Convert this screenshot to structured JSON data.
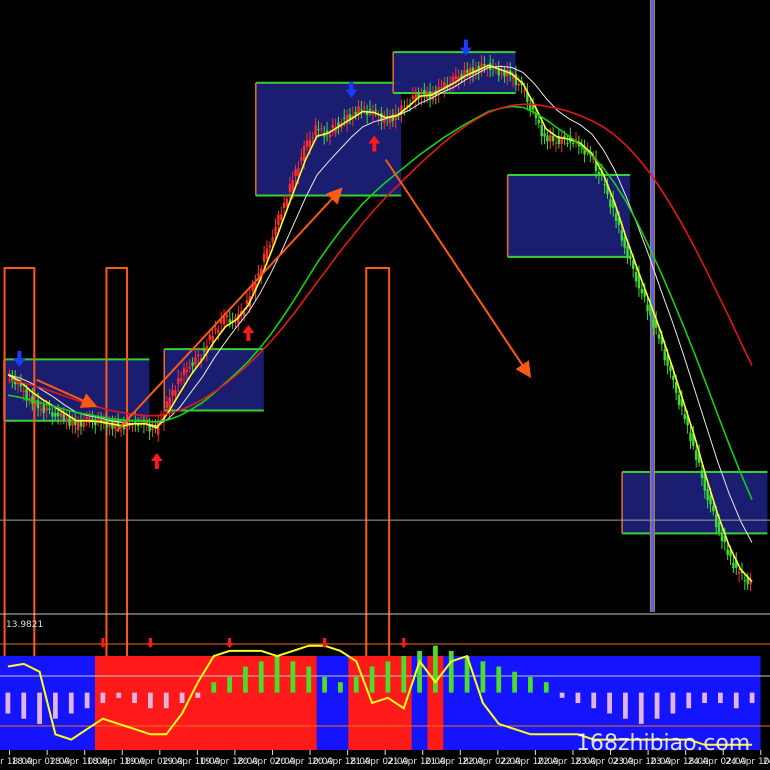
{
  "colors": {
    "background": "#000000",
    "bull_candle": "#ff2d2d",
    "bear_candle": "#3cdc3c",
    "zone_fill": "#1c1f7a",
    "zone_border_main": "#34d134",
    "zone_border_side": "#e8701e",
    "ma_white": "#e8e8e8",
    "ma_yellow": "#ffff33",
    "ma_green": "#16d016",
    "ma_red": "#e01818",
    "trend_arrow": "#ff5a14",
    "highlight_rect": "#ff5a14",
    "signal_up": "#ff1a1a",
    "signal_down": "#1e3cff",
    "vline": "#3a6cff",
    "hline": "#a0a0a0",
    "ind_blue": "#1414ff",
    "ind_red": "#ff1a1a",
    "ind_green_hist": "#4cdc2c",
    "ind_pink_hist": "#e2b4e2",
    "ind_yellow_line": "#ffff1e",
    "ind_level_line": "#e8701e",
    "separator": "#c8c8c8",
    "text": "#e0e0e0"
  },
  "chart_data": [
    {
      "type": "candlestick",
      "title": "",
      "price_series": [
        100,
        99,
        97.5,
        96.8,
        96.3,
        95.8,
        95,
        95.5,
        95.4,
        95.1,
        94.9,
        95.4,
        95.2,
        94.5,
        97,
        99.5,
        101,
        102,
        104,
        105.5,
        105.2,
        107,
        110,
        113,
        116,
        119,
        122,
        124,
        123.5,
        124.5,
        125.3,
        126,
        125.5,
        124.8,
        125.3,
        126.5,
        127.5,
        127.2,
        128,
        128.7,
        129.4,
        129.8,
        130.3,
        129.6,
        129.3,
        128,
        125.5,
        123.1,
        122.9,
        123,
        122.5,
        121.3,
        119,
        116,
        112.5,
        109.5,
        106.5,
        103.5,
        100,
        96.5,
        93,
        89,
        85.5,
        82.5,
        80.5,
        79.5
      ],
      "moving_averages": [
        {
          "color": "white",
          "values": [
            100,
            99.7,
            99.2,
            98.5,
            97.8,
            97,
            96.3,
            96,
            95.8,
            95.5,
            95.3,
            95.2,
            95.2,
            95,
            95.7,
            96.8,
            98.3,
            99.8,
            101.6,
            103.2,
            104.7,
            106.1,
            107.9,
            110,
            112.3,
            114.8,
            117.3,
            119.5,
            120.8,
            122,
            123.2,
            124.2,
            124.7,
            125,
            125.3,
            125.8,
            126.5,
            127,
            127.6,
            128.1,
            128.8,
            129.4,
            130,
            130.1,
            130,
            129.5,
            128.4,
            127,
            125.8,
            125,
            124.4,
            123.5,
            122,
            120,
            117.4,
            114.6,
            111.6,
            108.4,
            105.3,
            102,
            98.5,
            95,
            91.5,
            88.4,
            85.7,
            83.6
          ]
        },
        {
          "color": "yellow",
          "values": [
            100,
            99.4,
            98.4,
            97.6,
            96.9,
            96.2,
            95.5,
            95.5,
            95.4,
            95.2,
            95,
            95.2,
            95.2,
            94.8,
            96.3,
            98.2,
            100,
            101.5,
            103.2,
            104.7,
            105.4,
            106.8,
            109.2,
            112,
            115,
            118,
            121,
            123.3,
            123.6,
            124.3,
            125,
            125.7,
            125.6,
            125.1,
            125.3,
            126.2,
            127.2,
            127.3,
            127.9,
            128.5,
            129.2,
            129.7,
            130.2,
            129.8,
            129.4,
            128.4,
            126.3,
            124,
            123.2,
            123,
            122.6,
            121.6,
            119.6,
            116.8,
            113.4,
            110.3,
            107.3,
            104.3,
            100.9,
            97.4,
            93.9,
            90,
            86.4,
            83.3,
            81,
            79.8
          ]
        },
        {
          "color": "green",
          "values": [
            98,
            97.8,
            97.5,
            97.2,
            96.9,
            96.6,
            96.3,
            96.1,
            95.9,
            95.7,
            95.6,
            95.5,
            95.4,
            95.4,
            95.6,
            96,
            96.6,
            97.3,
            98.2,
            99.2,
            100.2,
            101.3,
            102.6,
            104,
            105.6,
            107.3,
            109.1,
            110.9,
            112.5,
            114,
            115.4,
            116.7,
            117.8,
            118.8,
            119.7,
            120.6,
            121.5,
            122.3,
            123.1,
            123.8,
            124.5,
            125.1,
            125.7,
            126,
            126.2,
            126.1,
            125.6,
            124.9,
            124.1,
            123.3,
            122.4,
            121.4,
            120.2,
            118.7,
            116.9,
            114.8,
            112.5,
            110.1,
            107.5,
            104.8,
            102,
            99.1,
            96.1,
            93.2,
            90.4,
            87.8
          ]
        },
        {
          "color": "red",
          "values": [
            99.5,
            99.3,
            99,
            98.7,
            98.3,
            97.9,
            97.5,
            97.1,
            96.8,
            96.5,
            96.3,
            96.1,
            96,
            96,
            96.2,
            96.5,
            97,
            97.6,
            98.3,
            99.1,
            100,
            101,
            102.1,
            103.3,
            104.6,
            106,
            107.5,
            109,
            110.5,
            112,
            113.4,
            114.8,
            116.1,
            117.3,
            118.4,
            119.5,
            120.6,
            121.6,
            122.6,
            123.5,
            124.3,
            125,
            125.6,
            126,
            126.3,
            126.4,
            126.4,
            126.2,
            126,
            125.7,
            125.3,
            124.8,
            124.2,
            123.4,
            122.4,
            121.2,
            119.8,
            118.2,
            116.4,
            114.5,
            112.4,
            110.2,
            107.9,
            105.6,
            103.2,
            100.9
          ]
        }
      ],
      "zones": [
        {
          "start": 0,
          "end": 12,
          "top": 101.5,
          "bottom": 95.5
        },
        {
          "start": 14,
          "end": 22,
          "top": 102.5,
          "bottom": 96.5
        },
        {
          "start": 22,
          "end": 34,
          "top": 128.5,
          "bottom": 117.5
        },
        {
          "start": 34,
          "end": 44,
          "top": 131.5,
          "bottom": 127.5
        },
        {
          "start": 44,
          "end": 54,
          "top": 119.5,
          "bottom": 111.5
        },
        {
          "start": 54,
          "end": 66,
          "top": 90.5,
          "bottom": 84.5
        }
      ],
      "signals": [
        {
          "index": 1,
          "dir": "down"
        },
        {
          "index": 13,
          "dir": "up"
        },
        {
          "index": 21,
          "dir": "up"
        },
        {
          "index": 30,
          "dir": "down"
        },
        {
          "index": 32,
          "dir": "up"
        },
        {
          "index": 40,
          "dir": "down"
        }
      ],
      "current_price_line": 85.8,
      "ylim": [
        78,
        136
      ],
      "watermark": "168zhibiao.com"
    },
    {
      "type": "histogram",
      "label": "13.9821",
      "x_tick_labels": [
        "17 Apr 18:00",
        "18 Apr 02:00",
        "18 Apr 10:00",
        "18 Apr 18:00",
        "19 Apr 02:00",
        "19 Apr 10:00",
        "19 Apr 18:00",
        "20 Apr 02:00",
        "20 Apr 10:00",
        "20 Apr 18:00",
        "21 Apr 02:00",
        "21 Apr 10:00",
        "21 Apr 18:00",
        "22 Apr 02:00",
        "22 Apr 10:00",
        "22 Apr 18:00",
        "23 Apr 02:00",
        "23 Apr 10:00",
        "23 Apr 18:00",
        "24 Apr 02:00",
        "24 Apr 10:00",
        "24 Apr 18:00",
        "25 Apr 02:00"
      ],
      "bg_state": [
        "blue",
        "blue",
        "blue",
        "blue",
        "blue",
        "blue",
        "red",
        "red",
        "red",
        "red",
        "red",
        "red",
        "red",
        "red",
        "red",
        "red",
        "red",
        "red",
        "red",
        "red",
        "blue",
        "blue",
        "red",
        "red",
        "red",
        "red",
        "blue",
        "red",
        "blue",
        "blue",
        "blue",
        "blue",
        "blue",
        "blue",
        "blue",
        "blue",
        "blue",
        "blue",
        "blue",
        "blue",
        "blue",
        "blue",
        "blue",
        "blue",
        "blue",
        "blue",
        "blue",
        "blue"
      ],
      "hist": [
        -4,
        -5,
        -6,
        -5,
        -4,
        -3,
        -2,
        -1,
        -2,
        -3,
        -3,
        -2,
        -1,
        2,
        3,
        5,
        6,
        7,
        6,
        5,
        3,
        2,
        3,
        5,
        6,
        7,
        8,
        9,
        8,
        7,
        6,
        5,
        4,
        3,
        2,
        -1,
        -2,
        -3,
        -4,
        -5,
        -6,
        -5,
        -4,
        -3,
        -2,
        -2,
        -3,
        -2
      ],
      "signal_line": [
        5,
        5.5,
        4,
        -8,
        -9,
        -7,
        -5,
        -6,
        -7,
        -8,
        -8,
        -4,
        2,
        7,
        8,
        8,
        8,
        7,
        8,
        9,
        9,
        8,
        6,
        -2,
        -1,
        -3,
        6,
        2,
        6,
        7,
        -2,
        -6,
        -7,
        -8,
        -8,
        -8,
        -8,
        -9,
        -9,
        -9,
        -9,
        -9,
        -9,
        -9,
        -10,
        -10,
        -10,
        -10
      ],
      "arrows": [
        6,
        9,
        14,
        20,
        25
      ],
      "ylim": [
        -11,
        12
      ]
    }
  ]
}
